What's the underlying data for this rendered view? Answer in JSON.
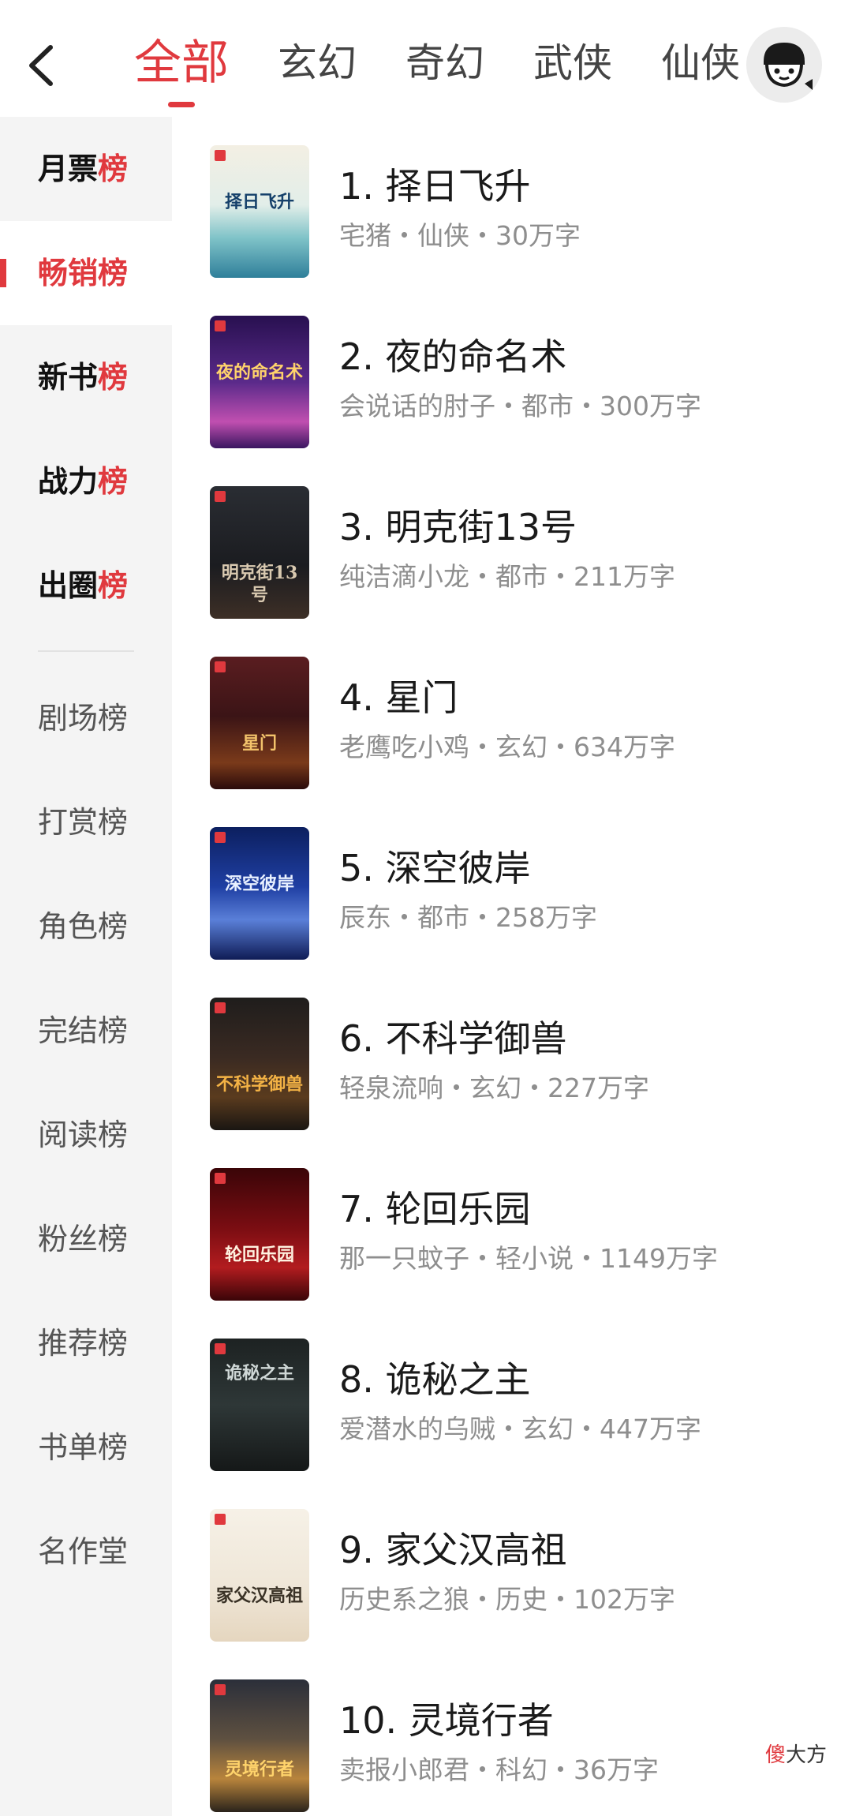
{
  "header": {
    "tabs": [
      "全部",
      "玄幻",
      "奇幻",
      "武侠",
      "仙侠"
    ],
    "active_tab_index": 0
  },
  "sidebar": {
    "top_items": [
      {
        "pre": "月票",
        "post": "榜"
      },
      {
        "pre": "畅销",
        "post": "榜"
      },
      {
        "pre": "新书",
        "post": "榜"
      },
      {
        "pre": "战力",
        "post": "榜"
      },
      {
        "pre": "出圈",
        "post": "榜"
      }
    ],
    "active_index": 1,
    "items": [
      "剧场榜",
      "打赏榜",
      "角色榜",
      "完结榜",
      "阅读榜",
      "粉丝榜",
      "推荐榜",
      "书单榜",
      "名作堂"
    ]
  },
  "books": [
    {
      "title": "1. 择日飞升",
      "meta": "宅猪・仙侠・30万字",
      "cover_text": "择日飞升"
    },
    {
      "title": "2. 夜的命名术",
      "meta": "会说话的肘子・都市・300万字",
      "cover_text": "夜的命名术"
    },
    {
      "title": "3. 明克街13号",
      "meta": "纯洁滴小龙・都市・211万字",
      "cover_text": "明克街13号"
    },
    {
      "title": "4. 星门",
      "meta": "老鹰吃小鸡・玄幻・634万字",
      "cover_text": "星门"
    },
    {
      "title": "5. 深空彼岸",
      "meta": "辰东・都市・258万字",
      "cover_text": "深空彼岸"
    },
    {
      "title": "6. 不科学御兽",
      "meta": "轻泉流响・玄幻・227万字",
      "cover_text": "不科学御兽"
    },
    {
      "title": "7. 轮回乐园",
      "meta": "那一只蚊子・轻小说・1149万字",
      "cover_text": "轮回乐园"
    },
    {
      "title": "8. 诡秘之主",
      "meta": "爱潜水的乌贼・玄幻・447万字",
      "cover_text": "诡秘之主"
    },
    {
      "title": "9. 家父汉高祖",
      "meta": "历史系之狼・历史・102万字",
      "cover_text": "家父汉高祖"
    },
    {
      "title": "10. 灵境行者",
      "meta": "卖报小郎君・科幻・36万字",
      "cover_text": "灵境行者"
    }
  ],
  "watermark": {
    "red": "傻",
    "black": "大方"
  },
  "colors": {
    "accent": "#e0393e",
    "sidebar_bg": "#f4f4f4",
    "meta_text": "#8e8e8e"
  }
}
